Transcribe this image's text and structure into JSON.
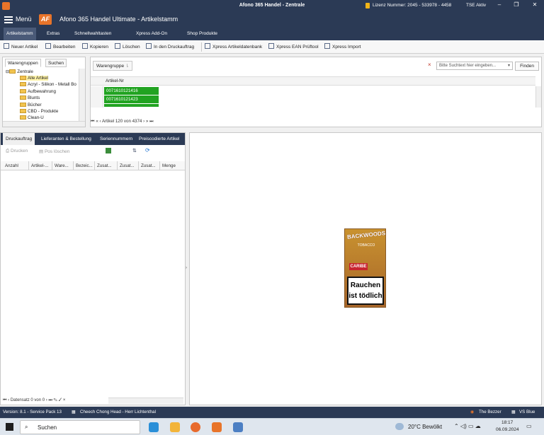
{
  "window": {
    "title": "Afono 365 Handel - Zentrale",
    "license": "Lizenz Nummer: 2045 - 533978 - 4458",
    "tse": "TSE Aktiv",
    "min": "–",
    "max": "❐",
    "close": "✕"
  },
  "menu": {
    "label": "Menü",
    "logo_text": "AF",
    "app_title": "Afono 365 Handel Ultimate - Artikelstamm"
  },
  "ribbon_tabs": [
    "Artikelstamm",
    "Extras",
    "Schnellwahltasten",
    "Xpress Add-On",
    "Shop Produkte"
  ],
  "toolbar": {
    "new": "Neuer Artikel",
    "edit": "Bearbeiten",
    "copy": "Kopieren",
    "delete": "Löschen",
    "print_job": "In den Druckauftrag",
    "xpress_db": "Xpress Artikeldatenbank",
    "xpress_ean": "Xpress EAN Prüftool",
    "xpress_import": "Xpress Import"
  },
  "tree": {
    "tabs": [
      "Warengruppen",
      "Suchen"
    ],
    "root": "Zentrale",
    "items": [
      "Alle Artikel",
      "Acryl - Silikon - Metall Bo",
      "Aufbewahrung",
      "Blunts",
      "Bücher",
      "CBD - Produkte",
      "Clean-U"
    ]
  },
  "grid": {
    "group_chip": "Warengruppe",
    "search_placeholder": "Bitte Suchtext hier eingeben...",
    "clear": "×",
    "find": "Finden",
    "column": "Artikel-Nr",
    "rows": [
      "0071610121416",
      "0071610121423"
    ],
    "nav": "Artikel 120 von 4374"
  },
  "bottom_tabs": [
    "Druckauftrag",
    "Lieferanten & Bestellung",
    "Seriennummern",
    "Preiscodierte Artikel"
  ],
  "print_toolbar": {
    "print": "Drucken",
    "delete_pos": "Pos löschen"
  },
  "columns": [
    "Anzahl",
    "Artikel-...",
    "Ware...",
    "Bezeic...",
    "Zusat...",
    "Zusat...",
    "Zusat...",
    "Menge"
  ],
  "records_nav": "Datensatz 0 von 0",
  "product_image": {
    "brand": "BACKWOODS",
    "sub": "TOBACCO",
    "flavor": "CARIBE",
    "warning_line1": "Rauchen",
    "warning_line2": "ist tödlich"
  },
  "status": {
    "version": "Version: 8.1 - Service Pack 13",
    "store": "Cheech Chong Head - Herr Lichtenthal",
    "bezzer": "The Bezzer",
    "theme": "VS Blue"
  },
  "taskbar": {
    "search": "Suchen",
    "weather": "20°C  Bewölkt",
    "time": "18:17",
    "date": "06.09.2024"
  }
}
